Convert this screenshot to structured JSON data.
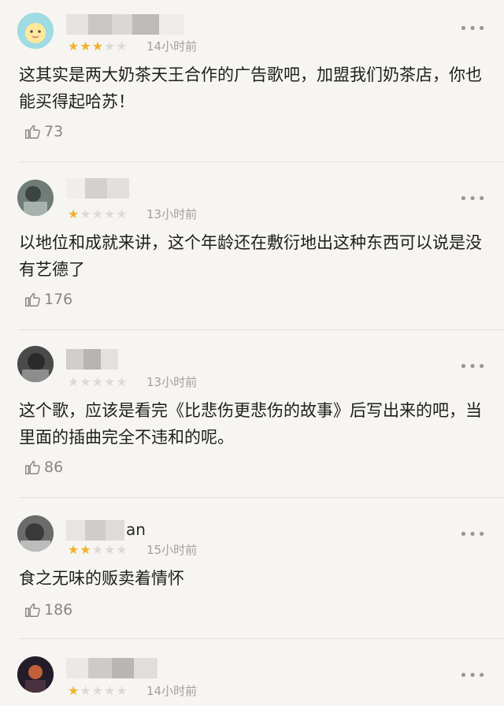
{
  "comments": [
    {
      "name_fragment": "",
      "rating": 3,
      "max_rating": 5,
      "time": "14小时前",
      "text": "这其实是两大奶茶天王合作的广告歌吧，加盟我们奶茶店，你也能买得起哈苏！",
      "likes": "73"
    },
    {
      "name_fragment": "",
      "rating": 1,
      "max_rating": 5,
      "time": "13小时前",
      "text": "以地位和成就来讲，这个年龄还在敷衍地出这种东西可以说是没有艺德了",
      "likes": "176"
    },
    {
      "name_fragment": "",
      "rating": 0,
      "max_rating": 5,
      "time": "13小时前",
      "text": "这个歌，应该是看完《比悲伤更悲伤的故事》后写出来的吧，当里面的插曲完全不违和的呢。",
      "likes": "86"
    },
    {
      "name_fragment": "an",
      "rating": 2,
      "max_rating": 5,
      "time": "15小时前",
      "text": "食之无味的贩卖着情怀",
      "likes": "186"
    },
    {
      "name_fragment": "",
      "rating": 1,
      "max_rating": 5,
      "time": "14小时前",
      "text": "",
      "likes": ""
    }
  ],
  "icons": {
    "more": "more-dots-icon",
    "like": "thumbs-up-icon",
    "star": "star-icon"
  },
  "colors": {
    "background": "#f7f5f1",
    "star_on": "#f0b429",
    "star_off": "#dcdad6",
    "meta_text": "#a3a09b"
  },
  "more_glyph": "•••"
}
